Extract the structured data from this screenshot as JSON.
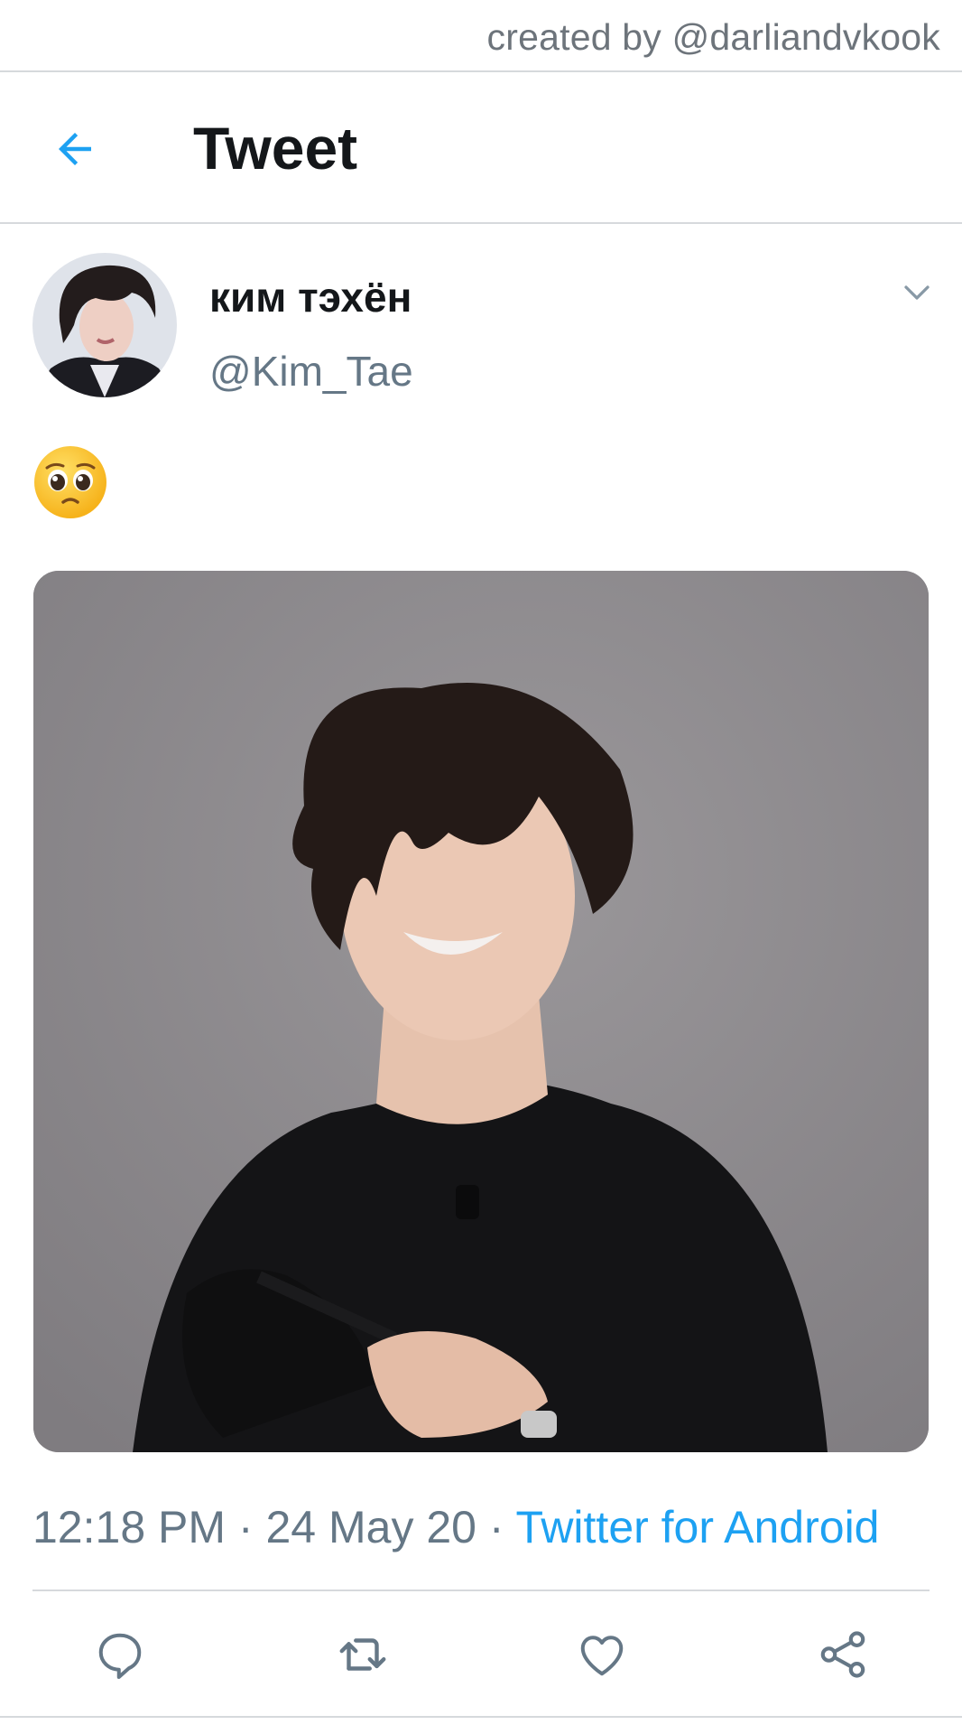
{
  "watermark": {
    "text": "created by @darliandvkook"
  },
  "header": {
    "title": "Tweet",
    "back_icon": "arrow-left-icon"
  },
  "author": {
    "display_name": "ким тэхён",
    "handle": "@Kim_Tae",
    "more_icon": "chevron-down-icon"
  },
  "tweet": {
    "emoji_icon": "pleading-face-emoji",
    "timestamp": "12:18 PM",
    "date": "24 May 20",
    "separator": "·",
    "source": "Twitter for Android"
  },
  "actions": [
    {
      "name": "reply",
      "icon": "reply-icon"
    },
    {
      "name": "retweet",
      "icon": "retweet-icon"
    },
    {
      "name": "like",
      "icon": "heart-icon"
    },
    {
      "name": "share",
      "icon": "share-icon"
    }
  ],
  "colors": {
    "accent": "#1da1f2",
    "text_primary": "#14171a",
    "text_secondary": "#657786",
    "divider": "#d6d9dc"
  }
}
